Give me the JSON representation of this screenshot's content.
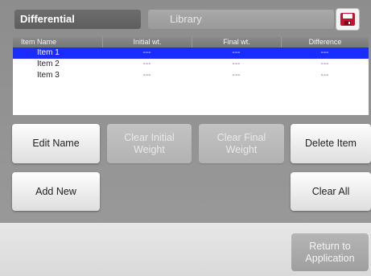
{
  "tabs": {
    "active": "Differential",
    "other": "Library"
  },
  "toolbar": {
    "save_icon": "floppy-disk-icon"
  },
  "table": {
    "headers": [
      "Item Name",
      "Initial wt.",
      "Final wt.",
      "Difference"
    ],
    "rows": [
      {
        "name": "Item 1",
        "initial": "---",
        "final": "---",
        "difference": "---",
        "selected": true
      },
      {
        "name": "Item 2",
        "initial": "---",
        "final": "---",
        "difference": "---",
        "selected": false
      },
      {
        "name": "Item 3",
        "initial": "---",
        "final": "---",
        "difference": "---",
        "selected": false
      }
    ]
  },
  "buttons": {
    "edit_name": "Edit Name",
    "clear_initial": "Clear Initial\nWeight",
    "clear_final": "Clear Final\nWeight",
    "delete_item": "Delete Item",
    "add_new": "Add New",
    "clear_all": "Clear All",
    "return": "Return to\nApplication"
  },
  "colors": {
    "selection": "#1a2cff",
    "header": "#7f7f7f",
    "background": "#959595"
  }
}
